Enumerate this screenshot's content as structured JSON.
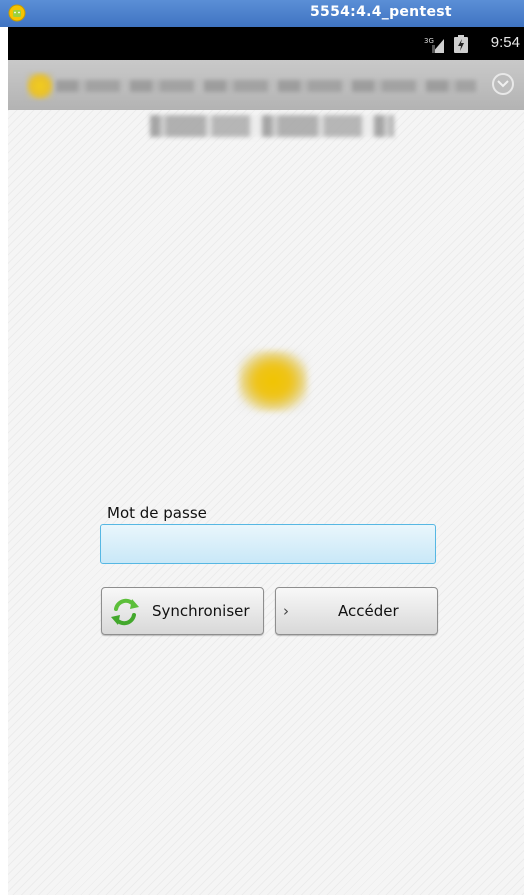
{
  "emulator": {
    "title": "5554:4.4_pentest"
  },
  "status_bar": {
    "network": "3G",
    "time": "9:54"
  },
  "login": {
    "password_label": "Mot de passe",
    "password_value": "",
    "sync_button_label": "Synchroniser",
    "access_button_label": "Accéder"
  },
  "colors": {
    "emulator_bar": "#4a80cc",
    "input_border": "#56b7e3",
    "brand_yellow": "#f0c400"
  }
}
